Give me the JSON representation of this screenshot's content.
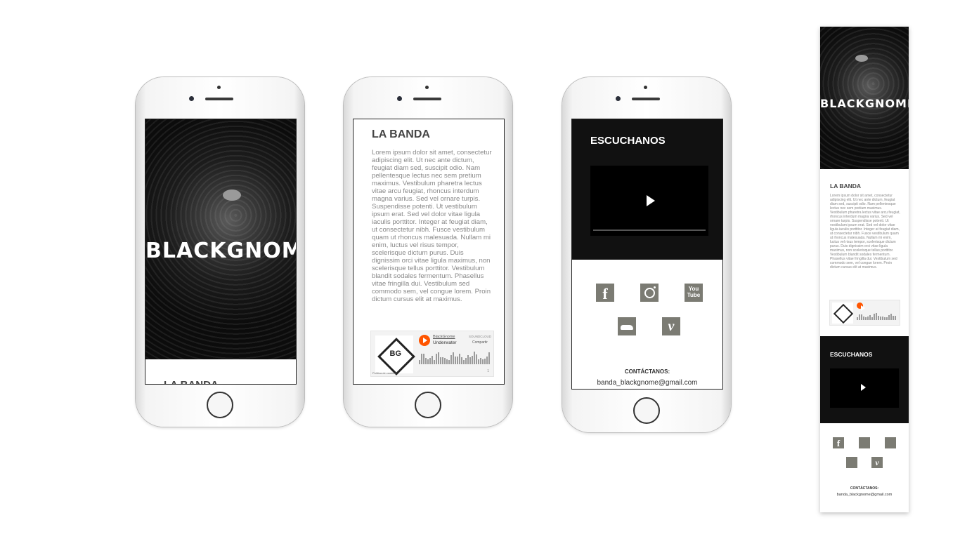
{
  "brand": {
    "logo_text": "BLACKGNOME"
  },
  "band_section": {
    "title": "LA BANDA",
    "body": "Lorem ipsum dolor sit amet, consectetur adipiscing elit. Ut nec ante dictum, feugiat diam sed, suscipit odio. Nam pellentesque lectus nec sem pretium maximus. Vestibulum pharetra lectus vitae arcu feugiat, rhoncus interdum magna varius. Sed vel ornare turpis. Suspendisse potenti. Ut vestibulum ipsum erat. Sed vel dolor vitae ligula iaculis porttitor. Integer at feugiat diam, ut consectetur nibh. Fusce vestibulum quam ut rhoncus malesuada. Nullam mi enim, luctus vel risus tempor, scelerisque dictum purus. Duis dignissim orci vitae ligula maximus, non scelerisque tellus porttitor. Vestibulum blandit sodales fermentum. Phasellus vitae fringilla dui. Vestibulum sed commodo sem, vel congue lorem. Proin dictum cursus elit at maximus."
  },
  "player": {
    "artist": "BlackGnome",
    "track": "Underwater",
    "source": "SOUNDCLOUD",
    "share_label": "Compartir",
    "cookie_label": "Política de cookies",
    "play_count": "1"
  },
  "listen_section": {
    "title": "ESCUCHANOS"
  },
  "social": {
    "facebook": "f",
    "youtube_line1": "You",
    "youtube_line2": "Tube",
    "vimeo": "v"
  },
  "contact": {
    "label": "CONTÁCTANOS:",
    "email": "banda_blackgnome@gmail.com"
  },
  "colors": {
    "icon_gray": "#7b7b73",
    "dark_section": "#111111",
    "accent": "#ff5500"
  }
}
